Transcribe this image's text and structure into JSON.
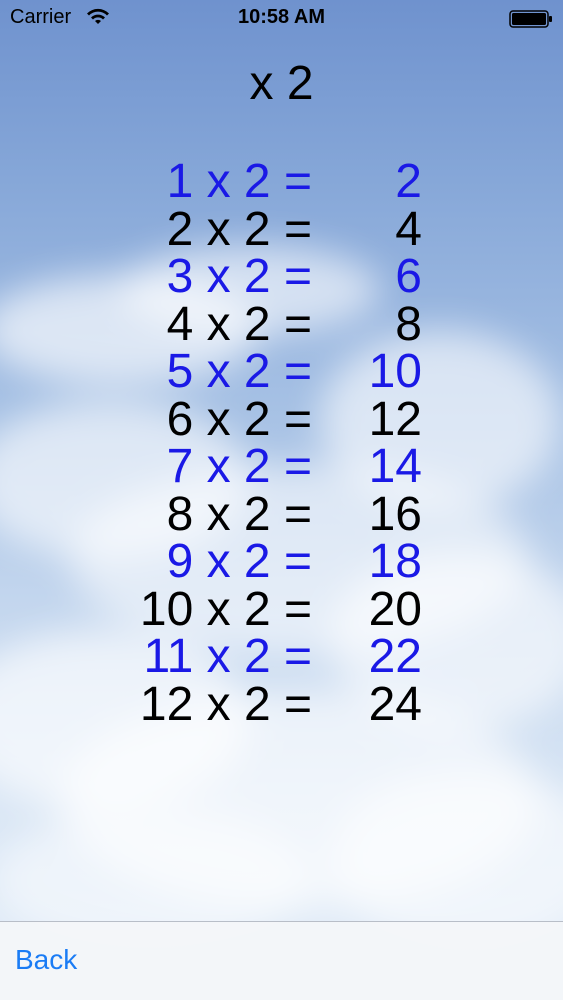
{
  "status_bar": {
    "carrier": "Carrier",
    "time": "10:58 AM"
  },
  "title": "x 2",
  "rows": [
    {
      "expr": "1 x 2 =",
      "result": "2",
      "color": "#1a19e6"
    },
    {
      "expr": "2 x 2 =",
      "result": "4",
      "color": "#000000"
    },
    {
      "expr": "3 x 2 =",
      "result": "6",
      "color": "#1a19e6"
    },
    {
      "expr": "4 x 2 =",
      "result": "8",
      "color": "#000000"
    },
    {
      "expr": "5 x 2 =",
      "result": "10",
      "color": "#1a19e6"
    },
    {
      "expr": "6 x 2 =",
      "result": "12",
      "color": "#000000"
    },
    {
      "expr": "7 x 2 =",
      "result": "14",
      "color": "#1a19e6"
    },
    {
      "expr": "8 x 2 =",
      "result": "16",
      "color": "#000000"
    },
    {
      "expr": "9 x 2 =",
      "result": "18",
      "color": "#1a19e6"
    },
    {
      "expr": "10 x 2 =",
      "result": "20",
      "color": "#000000"
    },
    {
      "expr": "11 x 2 =",
      "result": "22",
      "color": "#1a19e6"
    },
    {
      "expr": "12 x 2 =",
      "result": "24",
      "color": "#000000"
    }
  ],
  "toolbar": {
    "back_label": "Back"
  },
  "colors": {
    "accent": "#1a7cf5",
    "alternate_row": "#1a19e6",
    "row": "#000000"
  },
  "icons": [
    "wifi-icon",
    "battery-icon"
  ]
}
